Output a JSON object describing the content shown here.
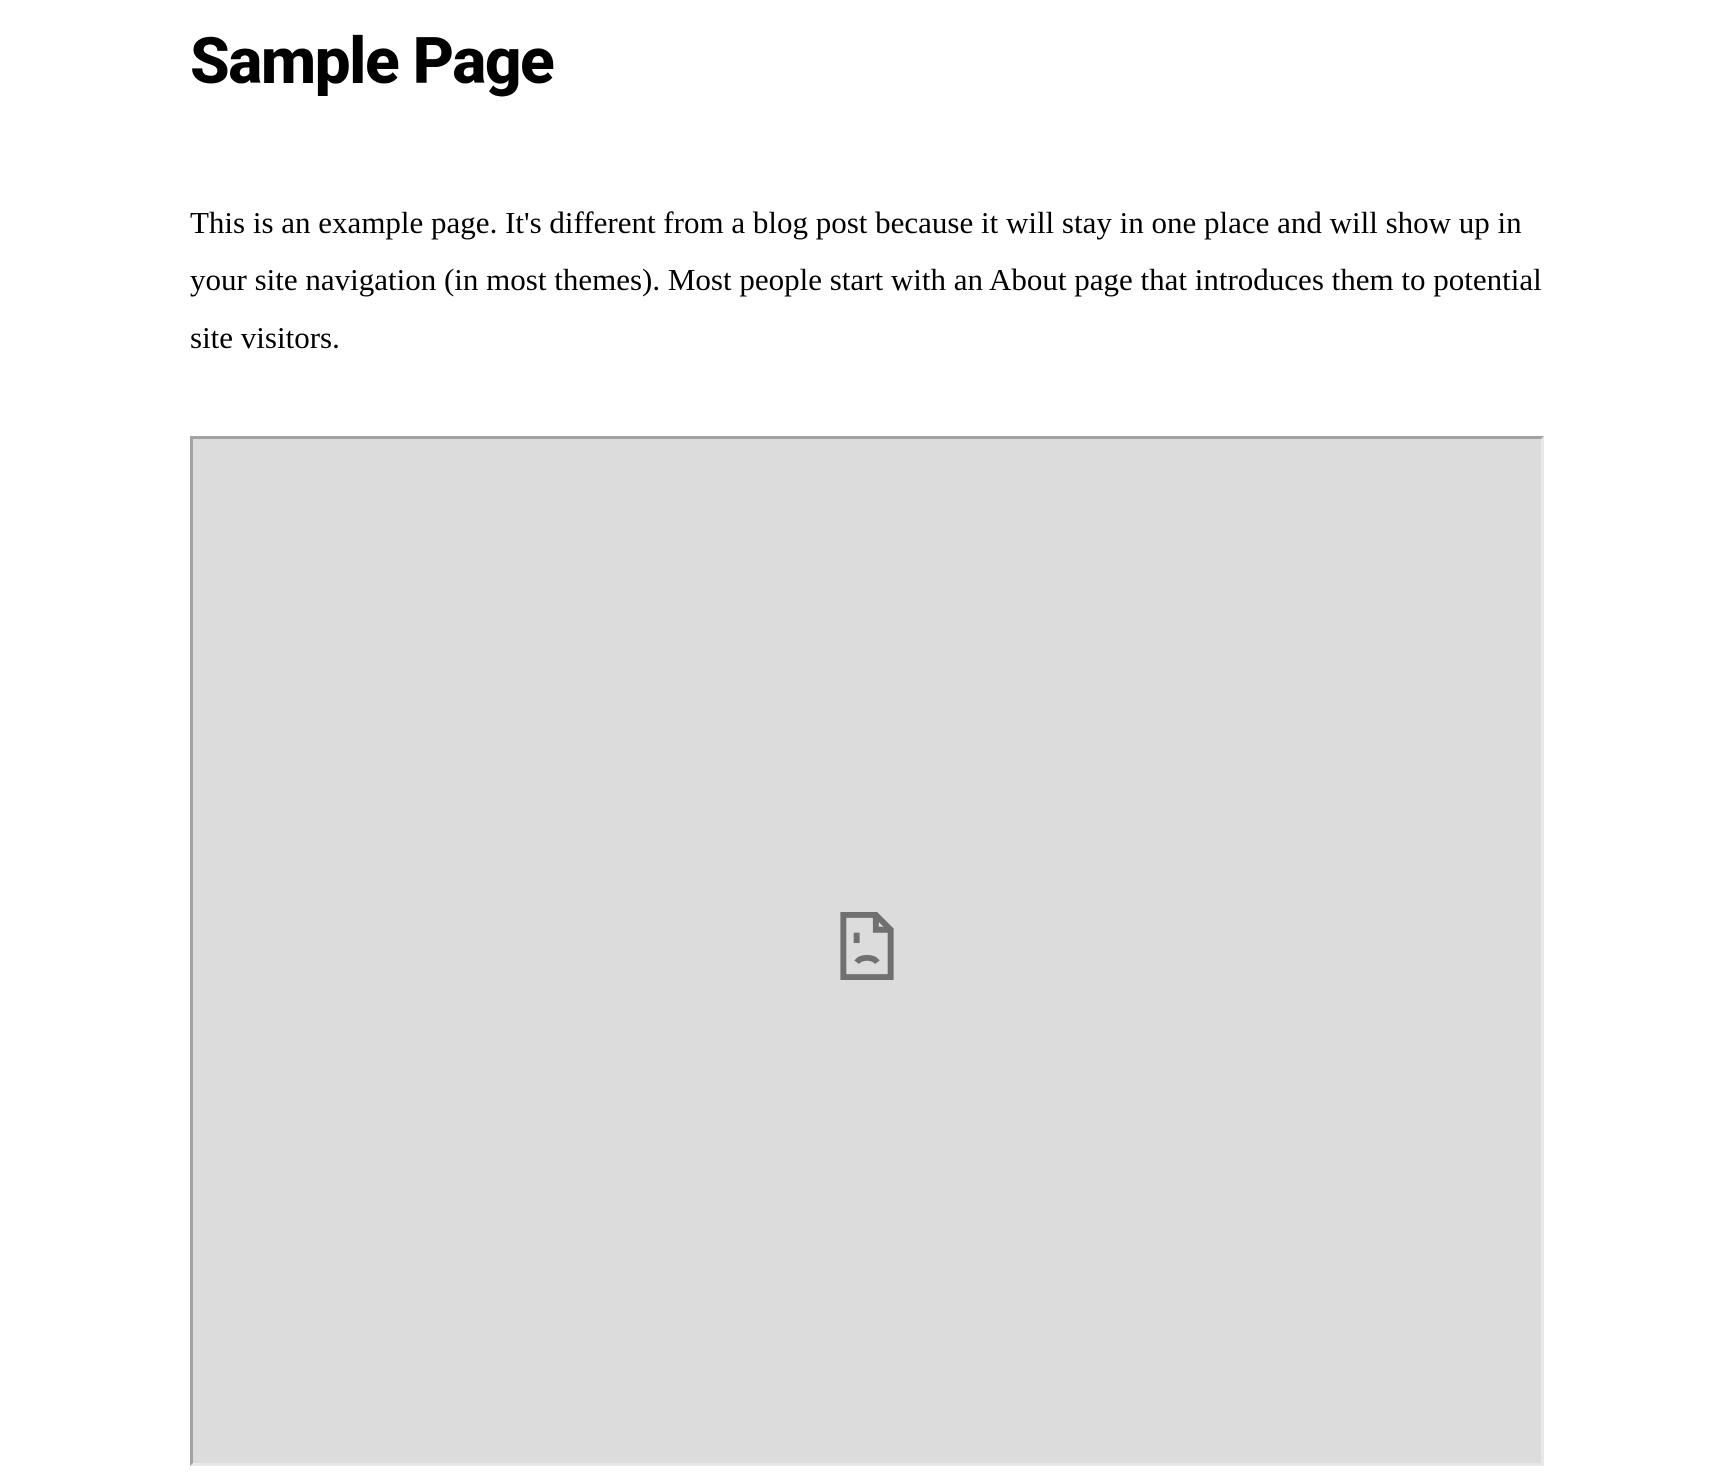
{
  "page": {
    "title": "Sample Page",
    "intro": "This is an example page. It's different from a blog post because it will stay in one place and will show up in your site navigation (in most themes). Most people start with an About page that introduces them to potential site visitors."
  },
  "embed": {
    "state": "broken",
    "icon_name": "broken-page-icon"
  }
}
